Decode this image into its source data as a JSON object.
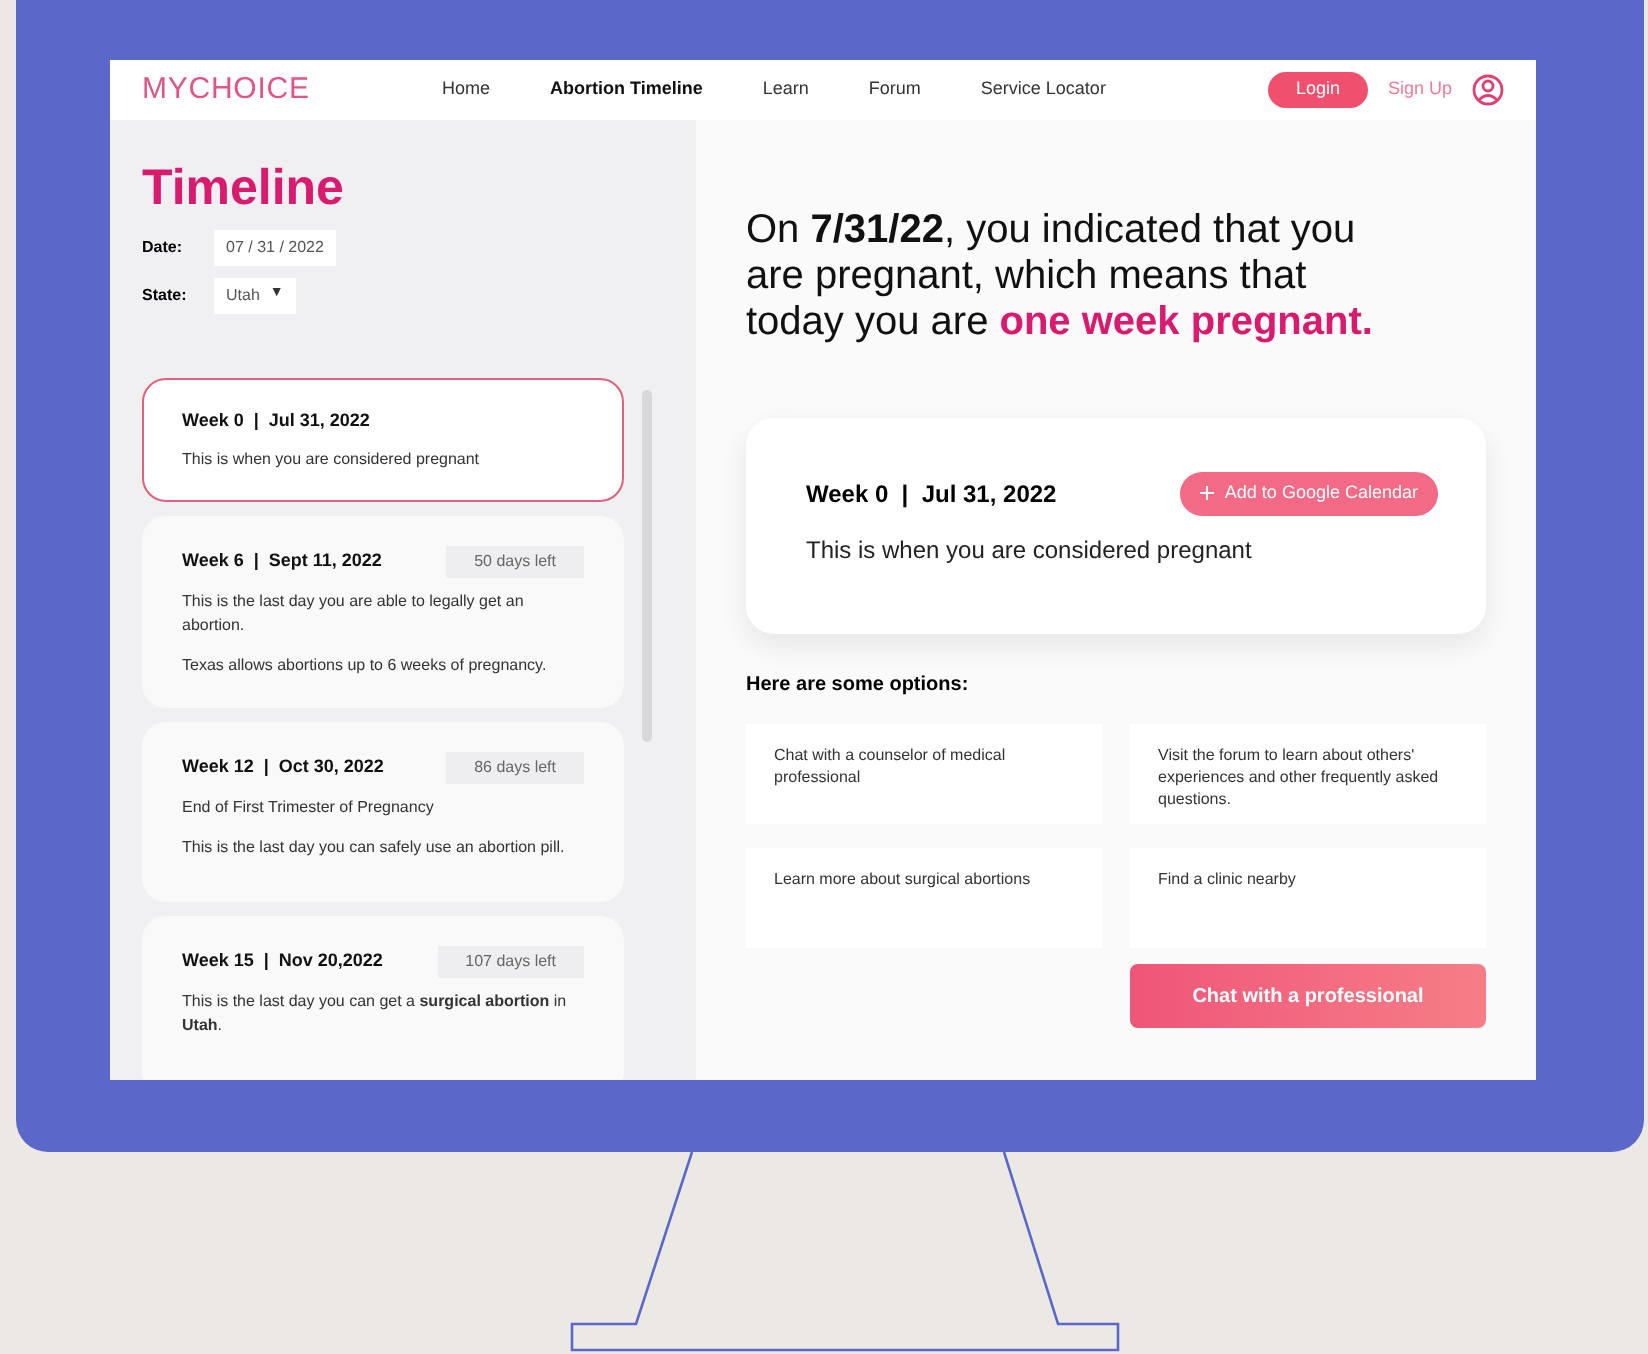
{
  "nav": {
    "logo": "MYCHOICE",
    "links": [
      {
        "label": "Home",
        "selected": false
      },
      {
        "label": "Abortion Timeline",
        "selected": true
      },
      {
        "label": "Learn",
        "selected": false
      },
      {
        "label": "Forum",
        "selected": false
      },
      {
        "label": "Service Locator",
        "selected": false
      }
    ],
    "login": "Login",
    "signup": "Sign Up"
  },
  "sidebar": {
    "title": "Timeline",
    "date_label": "Date:",
    "date_value": "07 / 31 / 2022",
    "state_label": "State:",
    "state_value": "Utah",
    "state_caret": "▼",
    "cards": [
      {
        "heading": "Week 0  |  Jul 31, 2022",
        "selected": true,
        "paragraphs": [
          "This is when you are considered pregnant"
        ]
      },
      {
        "heading": "Week 6  |  Sept 11, 2022",
        "days_left": "50 days left",
        "selected": false,
        "paragraphs": [
          "This is the last day you are able to legally get an abortion.",
          "Texas allows abortions up to 6 weeks of pregnancy."
        ]
      },
      {
        "heading": "Week 12  |  Oct 30, 2022",
        "days_left": "86 days left",
        "selected": false,
        "paragraphs": [
          "End of First Trimester of Pregnancy",
          "This is the last day you can safely use an abortion pill."
        ]
      },
      {
        "heading": "Week 15  |  Nov 20,2022",
        "days_left": "107 days left",
        "selected": false,
        "paragraphs": [
          "This is the last day you can get a **surgical abortion** in **Utah**."
        ]
      }
    ]
  },
  "main": {
    "headline": "On **7/31/22**, you indicated that you are pregnant, which means that today you are",
    "headline_highlight": "one week pregnant.",
    "detail": {
      "heading": "Week 0  |  Jul 31, 2022",
      "calendar_button": "Add to Google Calendar",
      "text": "This is when you are considered pregnant"
    },
    "options_title": "Here are some options:",
    "options": [
      "Chat with a counselor of medical professional",
      "Visit the forum to learn about others' experiences and other frequently asked questions.",
      "Learn more about surgical abortions",
      "Find a clinic nearby"
    ],
    "chat_button": "Chat with a professional"
  }
}
